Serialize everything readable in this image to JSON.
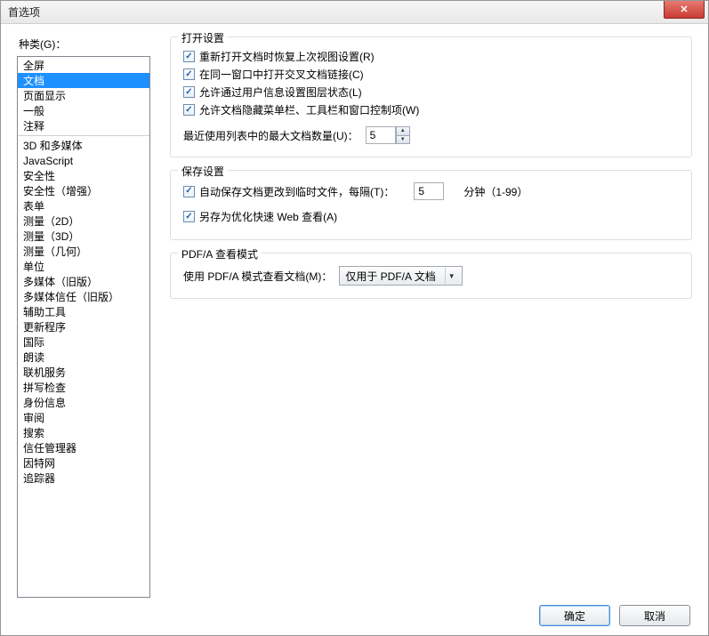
{
  "window": {
    "title": "首选项",
    "close_glyph": "✕"
  },
  "sidebar": {
    "label": "种类(G)：",
    "items_top": [
      "全屏",
      "文档",
      "页面显示",
      "一般",
      "注释"
    ],
    "items_bottom": [
      "3D 和多媒体",
      "JavaScript",
      "安全性",
      "安全性（增强）",
      "表单",
      "测量（2D）",
      "测量（3D）",
      "测量（几何）",
      "单位",
      "多媒体（旧版）",
      "多媒体信任（旧版）",
      "辅助工具",
      "更新程序",
      "国际",
      "朗读",
      "联机服务",
      "拼写检查",
      "身份信息",
      "审阅",
      "搜索",
      "信任管理器",
      "因特网",
      "追踪器"
    ],
    "selected_index": 1
  },
  "groups": {
    "open": {
      "legend": "打开设置",
      "cb_restore": "重新打开文档时恢复上次视图设置(R)",
      "cb_crossdoc": "在同一窗口中打开交叉文档链接(C)",
      "cb_layerstate": "允许通过用户信息设置图层状态(L)",
      "cb_hideui": "允许文档隐藏菜单栏、工具栏和窗口控制项(W)",
      "recent_label": "最近使用列表中的最大文档数量(U)：",
      "recent_value": "5"
    },
    "save": {
      "legend": "保存设置",
      "cb_autosave": "自动保存文档更改到临时文件，每隔(T)：",
      "autosave_value": "5",
      "autosave_suffix": "分钟（1-99）",
      "cb_fastweb": "另存为优化快速 Web 查看(A)"
    },
    "pdfa": {
      "legend": "PDF/A 查看模式",
      "label": "使用 PDF/A 模式查看文档(M)：",
      "selected": "仅用于 PDF/A 文档"
    }
  },
  "buttons": {
    "ok": "确定",
    "cancel": "取消"
  }
}
